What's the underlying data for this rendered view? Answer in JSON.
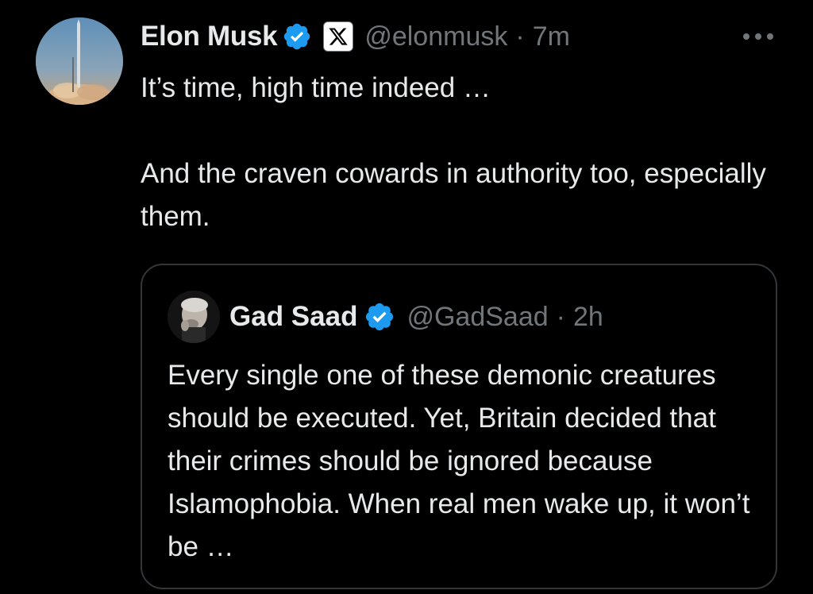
{
  "tweet": {
    "author_name": "Elon Musk",
    "author_handle": "@elonmusk",
    "separator": "·",
    "time_ago": "7m",
    "verified_color": "#1d9bf0",
    "more_icon": "more-horizontal-icon",
    "text_paragraphs": [
      "It’s time, high time indeed …",
      "And the craven cowards in authority too, especially them."
    ]
  },
  "quoted_tweet": {
    "author_name": "Gad Saad",
    "author_handle": "@GadSaad",
    "separator": "·",
    "time_ago": "2h",
    "text": "Every single one of these demonic creatures should be executed.  Yet, Britain decided that their crimes should be ignored because Islamophobia. When real men wake up, it won’t be …"
  },
  "colors": {
    "background": "#000000",
    "primary_text": "#e7e9ea",
    "secondary_text": "#71767b",
    "border": "#333639",
    "verified": "#1d9bf0"
  }
}
